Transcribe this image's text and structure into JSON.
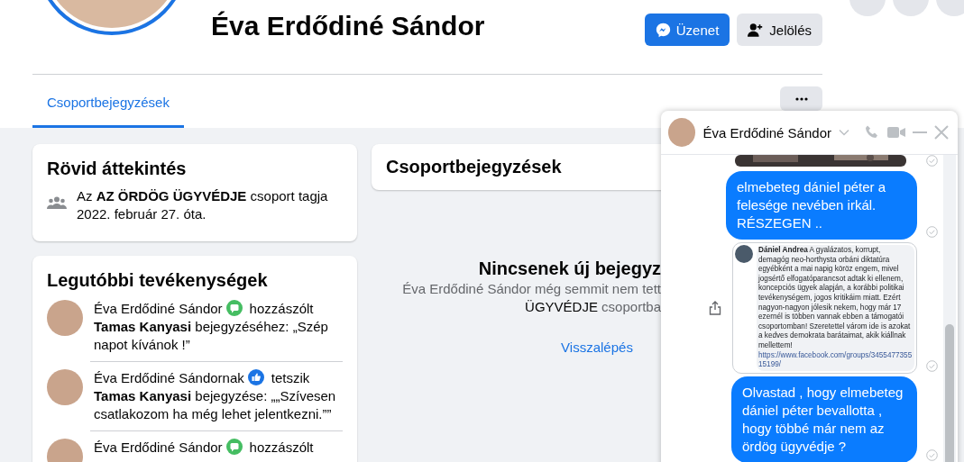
{
  "profile": {
    "name": "Éva Erdődiné Sándor",
    "buttons": [
      {
        "kind": "message",
        "label": "Üzenet"
      },
      {
        "kind": "tag",
        "label": "Jelölés"
      }
    ]
  },
  "tabs": [
    {
      "label": "Csoportbejegyzések",
      "selected": true
    }
  ],
  "overview": {
    "title": "Rövid áttekintés",
    "text": "Az **AZ ÖRDÖG ÜGYVÉDJE** csoport tagja 2022. február 27. óta."
  },
  "activity": {
    "title": "Legutóbbi tevékenységek",
    "items": [
      {
        "actor": "Éva Erdődiné Sándor",
        "kind": "comment",
        "verb": "hozzászólt",
        "text": "**Tamas Kanyasi** bejegyzéséhez: „Szép napot kívánok !”"
      },
      {
        "actor": "Éva Erdődiné Sándornak",
        "kind": "like",
        "verb": "tetszik",
        "text": "**Tamas Kanyasi** bejegyzése: „„Szívesen csatlakozom ha még lehet jelentkezni.””"
      },
      {
        "actor": "Éva Erdődiné Sándor",
        "kind": "comment",
        "verb": "hozzászólt"
      }
    ]
  },
  "posts": {
    "title": "Csoportbejegyzések",
    "empty_title": "Nincsenek új bejegyz",
    "empty_lines": [
      "Éva Erdődiné Sándor még semmit nem tett",
      "**ÜGYVÉDJE** csoportba"
    ],
    "back_link": "Visszalépés"
  },
  "chat": {
    "name": "Éva Erdődiné Sándor",
    "messages": [
      {
        "kind": "picture"
      },
      {
        "kind": "text",
        "text": "elmebeteg dániel péter a felesége nevében irkál. RÉSZEGEN .."
      },
      {
        "kind": "shared_comment",
        "author": "Dániel Andrea",
        "text": "A gyalázatos, korrupt, demagóg neo-horthysta orbáni diktatúra egyébként a mai napig köröz engem, mivel jogsértő elfogatóparancsot adtak ki ellenem, koncepciós ügyek alapján, a korábbi politikai tevékenységem, jogos kritikáim miatt. Ezért nagyon-nagyon jólesik nekem, hogy már 17 ezernél is többen vannak ebben a támogatói csoportomban! Szeretettel várom ide is azokat a kedves demokrata barátaimat, akik kiállnak mellettem!",
        "link": "https://www.facebook.com/groups/345547735515199/"
      },
      {
        "kind": "text",
        "text": "Olvastad , hogy elmebeteg dániel péter bevallotta , hogy többé már nem az ördög ügyvédje ?"
      }
    ]
  }
}
